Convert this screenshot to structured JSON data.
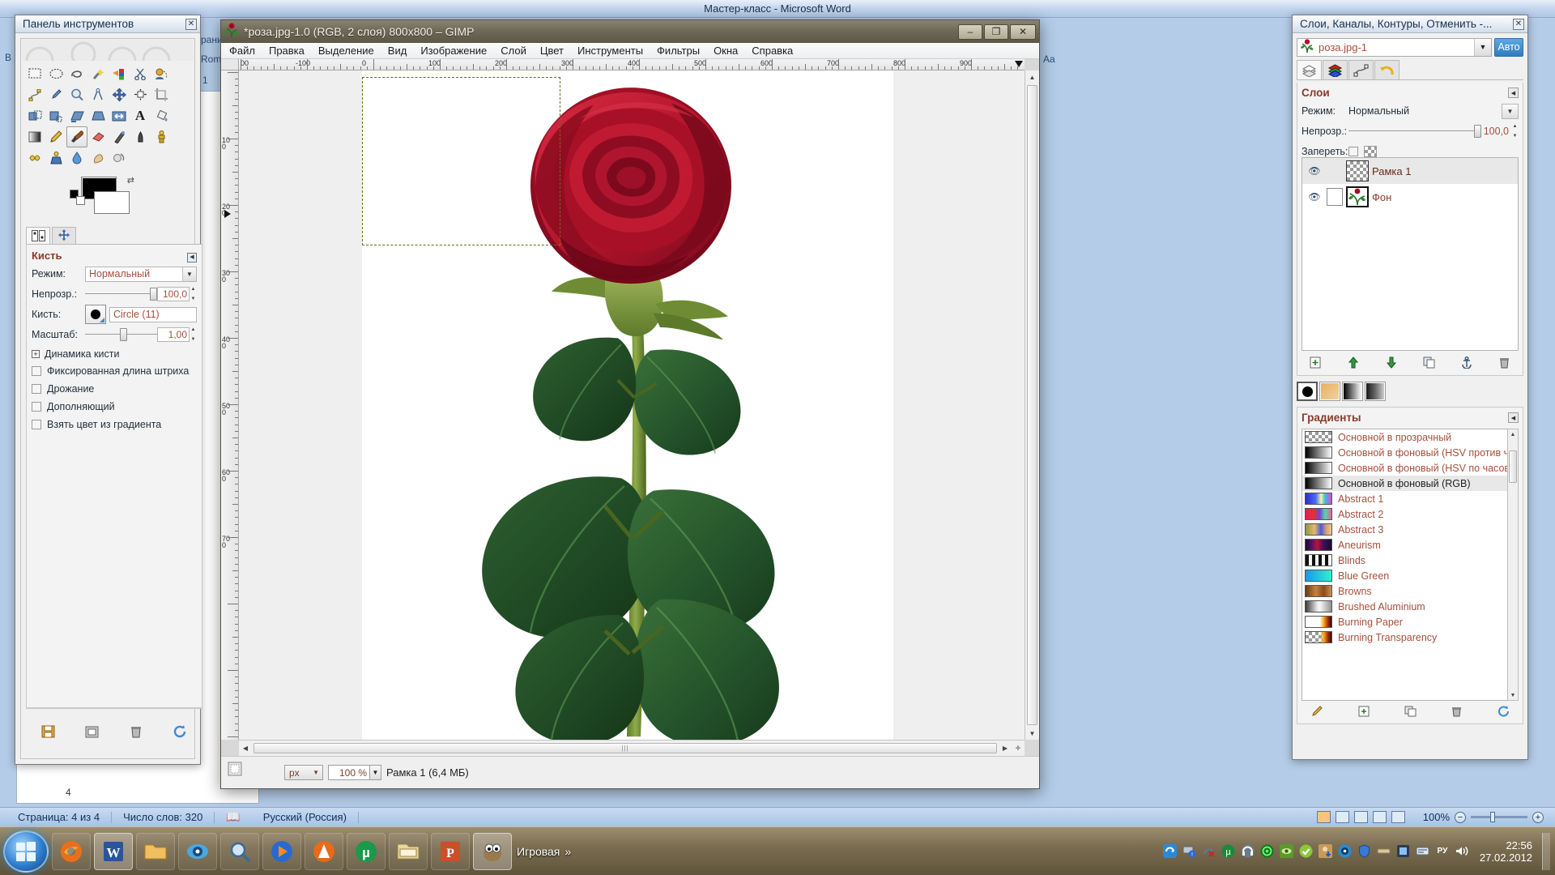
{
  "word": {
    "title": "Мастер-класс - Microsoft Word",
    "status": {
      "page": "Страница: 4 из 4",
      "words": "Число слов: 320",
      "lang": "Русский (Россия)",
      "proofing_icon": "spellcheck-icon",
      "zoom": "100%",
      "zoom_out": "−",
      "zoom_in": "+"
    },
    "ghost_labels": [
      "раниц",
      "Roma",
      "Aa",
      "B",
      "1"
    ],
    "page_number_badge": "4"
  },
  "toolbox": {
    "title": "Панель инструментов",
    "close_icon": "close-icon",
    "tools": [
      {
        "name": "rect-select-tool",
        "glyph": "▭"
      },
      {
        "name": "ellipse-select-tool",
        "glyph": "⬭"
      },
      {
        "name": "free-select-tool",
        "glyph": "➰"
      },
      {
        "name": "fuzzy-select-tool",
        "glyph": "✨"
      },
      {
        "name": "select-by-color-tool",
        "glyph": "🎨"
      },
      {
        "name": "scissors-select-tool",
        "glyph": "✂"
      },
      {
        "name": "foreground-select-tool",
        "glyph": "👤"
      },
      {
        "name": "paths-tool",
        "glyph": "✒"
      },
      {
        "name": "color-picker-tool",
        "glyph": "💉"
      },
      {
        "name": "zoom-tool",
        "glyph": "🔍"
      },
      {
        "name": "measure-tool",
        "glyph": "📐"
      },
      {
        "name": "move-tool",
        "glyph": "✛"
      },
      {
        "name": "align-tool",
        "glyph": "⊞"
      },
      {
        "name": "crop-tool",
        "glyph": "⌗"
      },
      {
        "name": "rotate-tool",
        "glyph": "⟳"
      },
      {
        "name": "scale-tool",
        "glyph": "⤢"
      },
      {
        "name": "shear-tool",
        "glyph": "◪"
      },
      {
        "name": "perspective-tool",
        "glyph": "◰"
      },
      {
        "name": "flip-tool",
        "glyph": "⇄"
      },
      {
        "name": "text-tool",
        "glyph": "A"
      },
      {
        "name": "bucket-fill-tool",
        "glyph": "🪣"
      },
      {
        "name": "blend-gradient-tool",
        "glyph": "▤"
      },
      {
        "name": "pencil-tool",
        "glyph": "✏"
      },
      {
        "name": "paintbrush-tool",
        "glyph": "🖌"
      },
      {
        "name": "eraser-tool",
        "glyph": "🧽"
      },
      {
        "name": "airbrush-tool",
        "glyph": "🖊"
      },
      {
        "name": "ink-tool",
        "glyph": "🖋"
      },
      {
        "name": "clone-tool",
        "glyph": "🔖"
      },
      {
        "name": "heal-tool",
        "glyph": "✚"
      },
      {
        "name": "perspective-clone-tool",
        "glyph": "🗝"
      },
      {
        "name": "blur-sharpen-tool",
        "glyph": "💧"
      },
      {
        "name": "smudge-tool",
        "glyph": "👆"
      },
      {
        "name": "dodge-burn-tool",
        "glyph": "🔅"
      }
    ],
    "selected_tool": "paintbrush-tool",
    "colors": {
      "foreground": "#000000",
      "background": "#ffffff"
    },
    "option_tabs": [
      "device-status-tab",
      "tool-options-tab"
    ],
    "tool_options": {
      "heading": "Кисть",
      "mode_label": "Режим:",
      "mode_value": "Нормальный",
      "opacity_label": "Непрозр.:",
      "opacity_value": "100,0",
      "brush_label": "Кисть:",
      "brush_value": "Circle (11)",
      "scale_label": "Масштаб:",
      "scale_value": "1,00",
      "dynamics_label": "Динамика кисти",
      "checkboxes": [
        "Фиксированная длина штриха",
        "Дрожание",
        "Дополняющий",
        "Взять цвет из градиента"
      ]
    },
    "bottom_buttons": [
      "save-tool-options",
      "restore-tool-options",
      "delete-tool-options",
      "reset-tool-options"
    ]
  },
  "gimp": {
    "title": "*роза.jpg-1.0 (RGB, 2 слоя) 800x800 – GIMP",
    "app_icon": "rose-icon",
    "window_buttons": {
      "minimize": "–",
      "maximize": "❐",
      "close": "✕"
    },
    "menus": [
      "Файл",
      "Правка",
      "Выделение",
      "Вид",
      "Изображение",
      "Слой",
      "Цвет",
      "Инструменты",
      "Фильтры",
      "Окна",
      "Справка"
    ],
    "ruler_h_labels": [
      "00",
      "-100",
      "0",
      "100",
      "200",
      "300",
      "400",
      "500",
      "600",
      "700",
      "800",
      "900"
    ],
    "ruler_v_labels": [
      "100",
      "200",
      "300",
      "400",
      "500",
      "600",
      "700"
    ],
    "statusbar": {
      "unit": "px",
      "zoom": "100 %",
      "message": "Рамка 1 (6,4 МБ)"
    },
    "selection_present": true
  },
  "dock": {
    "title": "Слои, Каналы, Контуры, Отменить -...",
    "close_icon": "close-icon",
    "image_name": "роза.jpg-1",
    "image_icon": "rose-icon",
    "auto_button": "Авто",
    "tabs": [
      {
        "name": "layers-tab",
        "glyph": "▤"
      },
      {
        "name": "channels-tab",
        "glyph": "📚"
      },
      {
        "name": "paths-tab",
        "glyph": "✒"
      },
      {
        "name": "undo-history-tab",
        "glyph": "↩"
      }
    ],
    "layers": {
      "heading": "Слои",
      "mode_label": "Режим:",
      "mode_value": "Нормальный",
      "opacity_label": "Непрозр.:",
      "opacity_value": "100,0",
      "lock_label": "Запереть:",
      "rows": [
        {
          "name": "Рамка 1",
          "visible": true,
          "selected": true,
          "thumb": "checker"
        },
        {
          "name": "Фон",
          "visible": true,
          "selected": false,
          "thumb": "rose"
        }
      ],
      "buttons": [
        "new-layer",
        "raise-layer",
        "lower-layer",
        "duplicate-layer",
        "anchor-layer",
        "delete-layer"
      ]
    },
    "brush_strip": [
      {
        "name": "brush-swatch",
        "glyph": "●"
      },
      {
        "name": "pattern-swatch",
        "glyph": ""
      },
      {
        "name": "gradient-swatch",
        "glyph": ""
      },
      {
        "name": "palette-swatch",
        "glyph": ""
      }
    ],
    "gradients": {
      "heading": "Градиенты",
      "items": [
        {
          "name": "Основной в прозрачный",
          "selected": false,
          "css": "linear-gradient(90deg,#1c1c1c,rgba(0,0,0,0))"
        },
        {
          "name": "Основной в фоновый  (HSV против ч",
          "selected": false,
          "css": "linear-gradient(90deg,#000,#fff)"
        },
        {
          "name": "Основной в фоновый (HSV по часов",
          "selected": false,
          "css": "linear-gradient(90deg,#000,#fff)"
        },
        {
          "name": "Основной в фоновый (RGB)",
          "selected": true,
          "css": "linear-gradient(90deg,#000,#fff)"
        },
        {
          "name": "Abstract 1",
          "selected": false,
          "css": "linear-gradient(90deg,#2b2bd6,#4b6ef5 40%,#f5f5a0 60%,#38c0e0 75%,#d84bd8)"
        },
        {
          "name": "Abstract 2",
          "selected": false,
          "css": "linear-gradient(90deg,#e8175d,#e83030 30%,#7a3fd8 55%,#4fd8a8 75%,#e85fa0)"
        },
        {
          "name": "Abstract 3",
          "selected": false,
          "css": "linear-gradient(90deg,#8a9a3a,#e8b870 35%,#4a5ad8 60%,#d8a070 80%,#e8c890)"
        },
        {
          "name": "Aneurism",
          "selected": false,
          "css": "linear-gradient(90deg,#1a0a2a,#5a1070 25%,#c01030 45%,#3a1060 70%,#1a0a2a)"
        },
        {
          "name": "Blinds",
          "selected": false,
          "css": "repeating-linear-gradient(90deg,#111 0 4px,#f5f5f5 4px 8px)"
        },
        {
          "name": "Blue Green",
          "selected": false,
          "css": "linear-gradient(90deg,#1898e8,#30f0d0)"
        },
        {
          "name": "Browns",
          "selected": false,
          "css": "linear-gradient(90deg,#6a3a14,#c88040 40%,#8a4a18 70%,#c89050)"
        },
        {
          "name": "Brushed Aluminium",
          "selected": false,
          "css": "linear-gradient(90deg,#3a3a3a,#e8e8e8 45%,#f8f8f8 55%,#909090)"
        },
        {
          "name": "Burning Paper",
          "selected": false,
          "css": "linear-gradient(90deg,#fff 0 55%,#f0b020 70%,#c03010 85%,#201008)"
        },
        {
          "name": "Burning Transparency",
          "selected": false,
          "css": "linear-gradient(90deg,rgba(0,0,0,0) 0 55%,#f0b020 70%,#c03010 85%,#201008)"
        }
      ],
      "buttons": [
        "edit-gradient",
        "new-gradient",
        "duplicate-gradient",
        "delete-gradient",
        "refresh-gradients"
      ]
    }
  },
  "taskbar": {
    "start": "start-orb",
    "items": [
      {
        "name": "taskbar-firefox",
        "glyph": "🦊"
      },
      {
        "name": "taskbar-word",
        "glyph": "W",
        "active": true
      },
      {
        "name": "taskbar-folder",
        "glyph": "📁"
      },
      {
        "name": "taskbar-photo-viewer",
        "glyph": "👁"
      },
      {
        "name": "taskbar-magnifier",
        "glyph": "🔎"
      },
      {
        "name": "taskbar-media-player",
        "glyph": "▶"
      },
      {
        "name": "taskbar-avast",
        "glyph": "🅰"
      },
      {
        "name": "taskbar-utorrent",
        "glyph": "µ"
      },
      {
        "name": "taskbar-explorer",
        "glyph": "🗂"
      },
      {
        "name": "taskbar-powerpoint",
        "glyph": "P"
      },
      {
        "name": "taskbar-gimp",
        "glyph": "🖌",
        "active": true
      }
    ],
    "toolbar_label": "Игровая",
    "toolbar_chevron": "»",
    "tray": [
      {
        "name": "tray-sync-icon",
        "glyph": "🔄"
      },
      {
        "name": "tray-network-alert-icon",
        "glyph": "💻"
      },
      {
        "name": "tray-disconnected-icon",
        "glyph": "🔌"
      },
      {
        "name": "tray-utorrent-icon",
        "glyph": "µ"
      },
      {
        "name": "tray-headset-icon",
        "glyph": "🎧"
      },
      {
        "name": "tray-target-icon",
        "glyph": "◎"
      },
      {
        "name": "tray-nvidia-icon",
        "glyph": "👁"
      },
      {
        "name": "tray-check-icon",
        "glyph": "✔"
      },
      {
        "name": "tray-download-icon",
        "glyph": "⬇"
      },
      {
        "name": "tray-eye-icon",
        "glyph": "◉"
      },
      {
        "name": "tray-shield-icon",
        "glyph": "🛡"
      },
      {
        "name": "tray-bar-icon",
        "glyph": "▬"
      },
      {
        "name": "tray-app-icon",
        "glyph": "⬛"
      },
      {
        "name": "tray-keyboard-icon",
        "glyph": "⌨"
      },
      {
        "name": "tray-layout-icon",
        "glyph": "РУ"
      },
      {
        "name": "tray-volume-icon",
        "glyph": "🔊"
      }
    ],
    "time": "22:56",
    "date": "27.02.2012",
    "show-desktop": "show-desktop-button"
  }
}
